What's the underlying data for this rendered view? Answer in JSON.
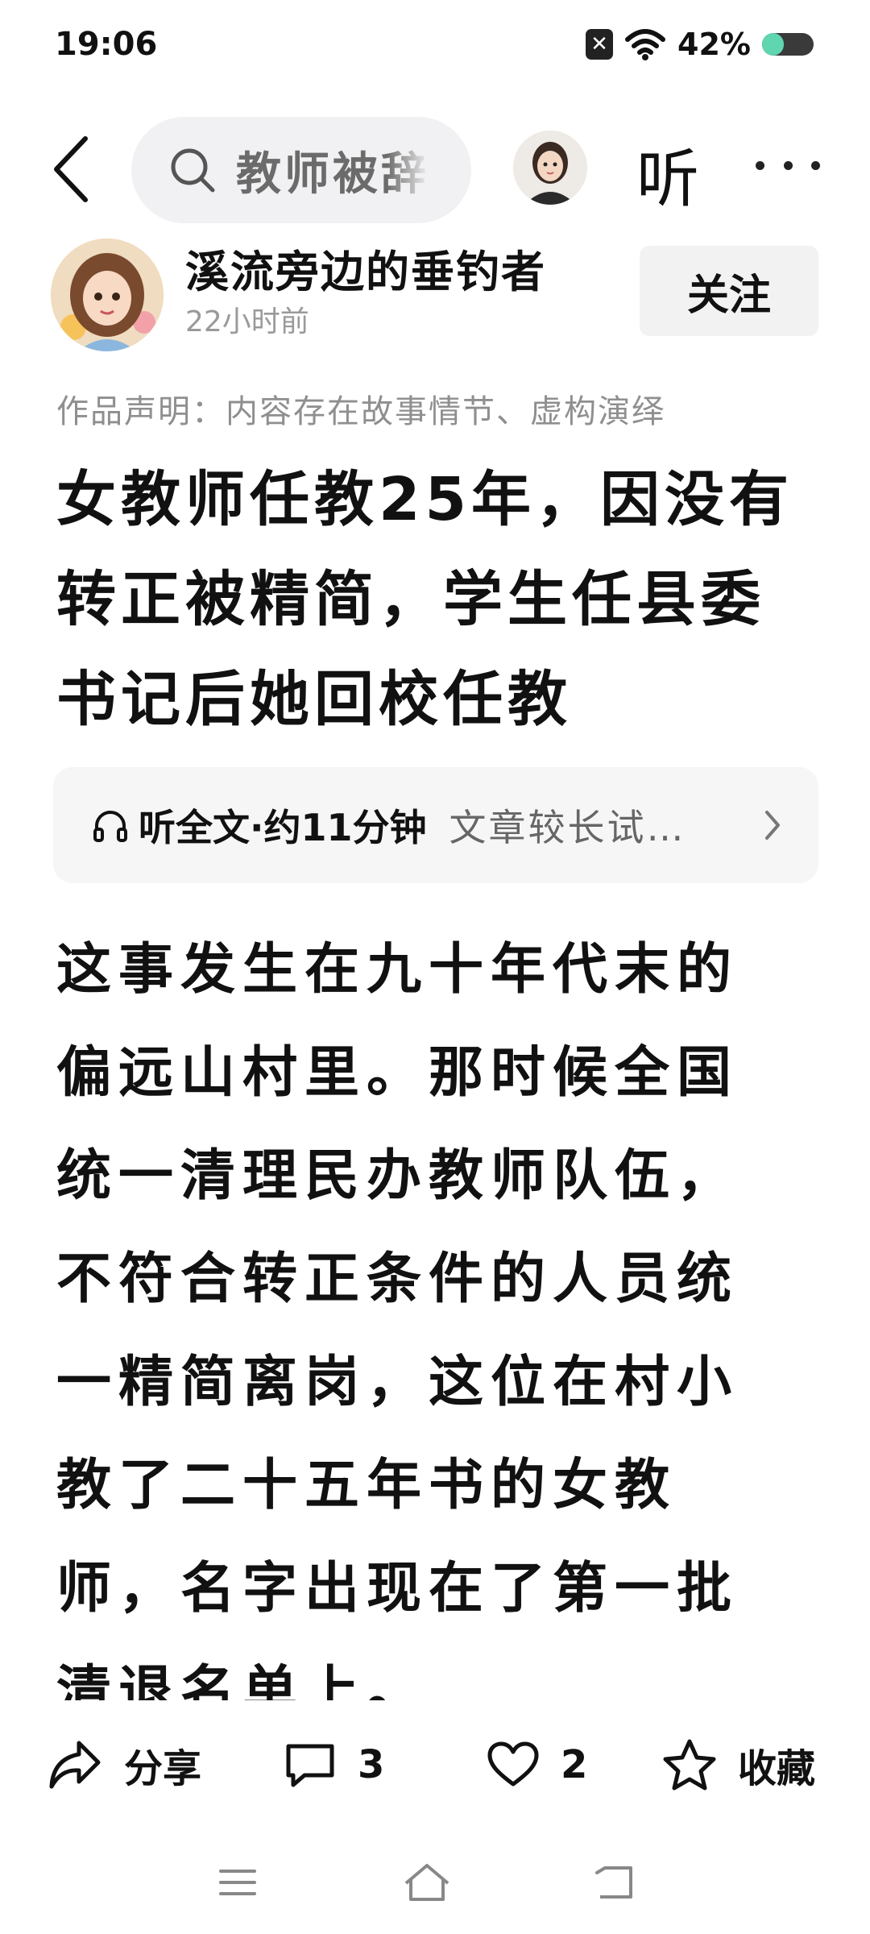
{
  "status_bar": {
    "time": "19:06",
    "battery_percent_text": "42%",
    "battery_level": 0.42,
    "sim_icon": "x-badge-icon",
    "wifi_icon": "wifi-icon"
  },
  "search": {
    "text": "教师被辞"
  },
  "header": {
    "listen_label": "听"
  },
  "author": {
    "name": "溪流旁边的垂钓者",
    "time_ago": "22小时前",
    "follow_label": "关注"
  },
  "article": {
    "declaration": "作品声明：内容存在故事情节、虚构演绎",
    "title": "女教师任教25年，因没有转正被精简，学生任县委书记后她回校任教",
    "listen_bar": {
      "label": "听全文·约11分钟",
      "description": "文章较长试试收听"
    },
    "body": "这事发生在九十年代末的偏远山村里。那时候全国统一清理民办教师队伍，不符合转正条件的人员统一精简离岗，这位在村小教了二十五年书的女教师，名字出现在了第一批清退名单上。"
  },
  "actions": {
    "share_label": "分享",
    "comment_count": "3",
    "like_count": "2",
    "collect_label": "收藏"
  },
  "colors": {
    "accent_battery": "#5fd6b0",
    "search_bg": "#f1f1f3",
    "muted_text": "#9a9a9a"
  }
}
